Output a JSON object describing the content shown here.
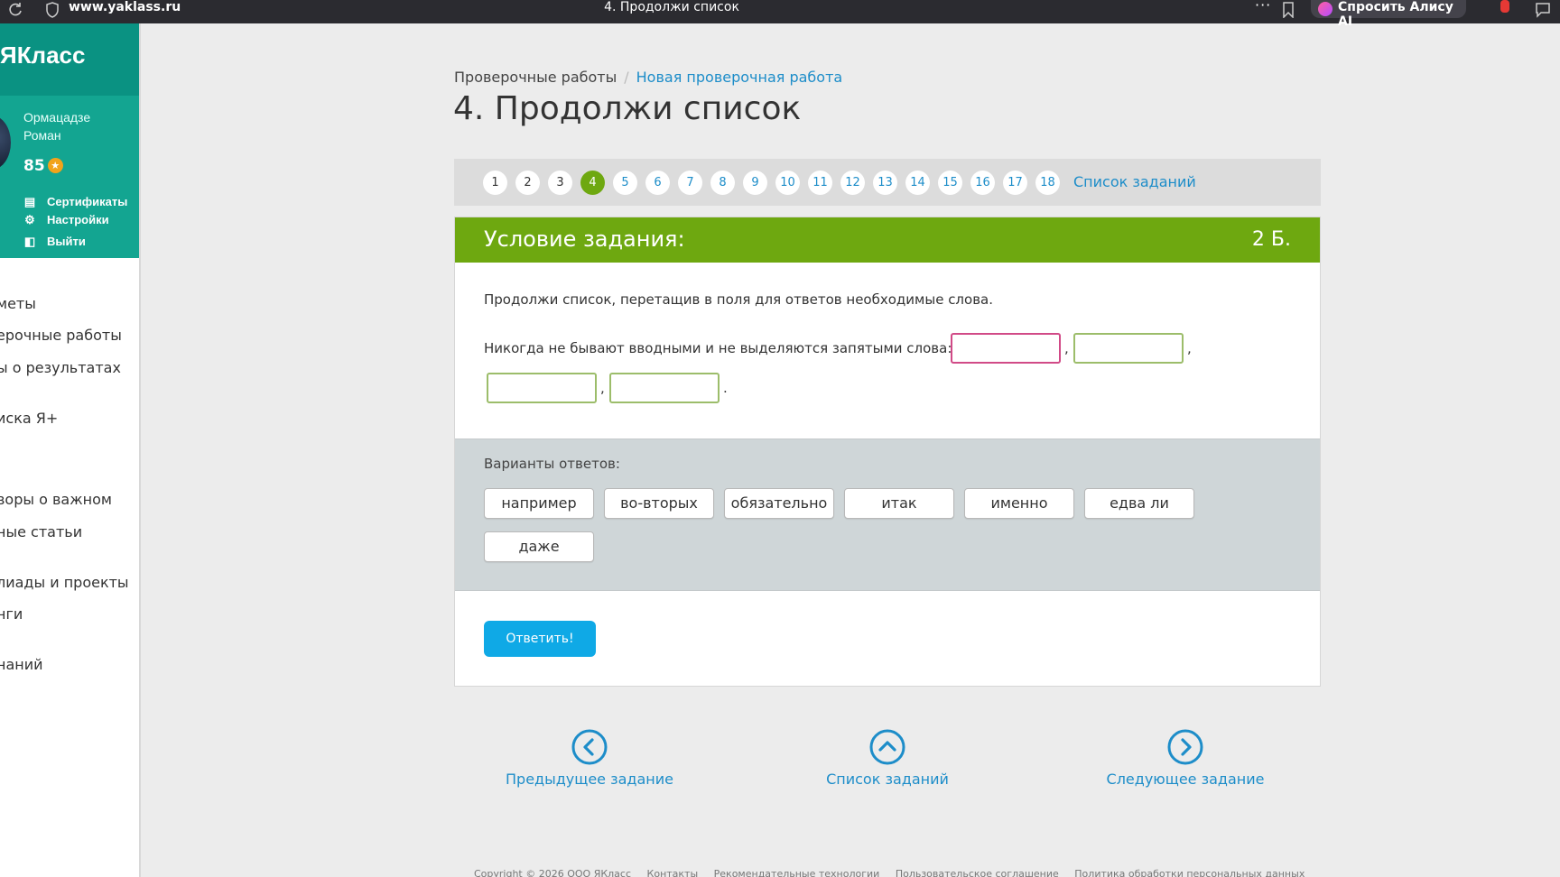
{
  "browser": {
    "url": "www.yaklass.ru",
    "tab_title": "4. Продолжи список",
    "alice_label": "Спросить Алису AI"
  },
  "sidebar": {
    "logo": "ЯКласс",
    "user_name_line1": "Ормацадзе",
    "user_name_line2": "Роман",
    "points": "85",
    "links": [
      "Сертификаты",
      "Настройки",
      "Выйти"
    ],
    "nav": [
      "меты",
      "ерочные работы",
      "ы о результатах",
      "иска Я+",
      "",
      "воры о важном",
      "ные статьи",
      "лиады и проекты",
      "нги",
      "наний"
    ]
  },
  "breadcrumb": {
    "root": "Проверочные работы",
    "current": "Новая проверочная работа"
  },
  "page_title": "4. Продолжи список",
  "pager": {
    "numbers": [
      "1",
      "2",
      "3",
      "4",
      "5",
      "6",
      "7",
      "8",
      "9",
      "10",
      "11",
      "12",
      "13",
      "14",
      "15",
      "16",
      "17",
      "18"
    ],
    "active": "4",
    "task_list_label": "Список заданий"
  },
  "task": {
    "header": "Условие задания:",
    "points": "2 Б.",
    "instruction": "Продолжи список, перетащив в поля для ответов необходимые слова.",
    "question": "Никогда не бывают вводными и не выделяются запятыми слова:",
    "options_label": "Варианты ответов:",
    "options": [
      "например",
      "во-вторых",
      "обязательно",
      "итак",
      "именно",
      "едва ли",
      "даже"
    ],
    "submit_label": "Ответить!"
  },
  "bottom_nav": {
    "prev": "Предыдущее задание",
    "list": "Список заданий",
    "next": "Следующее задание"
  },
  "footer": [
    "Copyright © 2026 ООО ЯКласс",
    "Контакты",
    "Рекомендательные технологии",
    "Пользовательское соглашение",
    "Политика обработки персональных данных"
  ],
  "colors": {
    "brand_teal": "#0a9282",
    "task_green": "#6ea810",
    "link_blue": "#1d8dc9",
    "submit_blue": "#0fa9e6"
  }
}
